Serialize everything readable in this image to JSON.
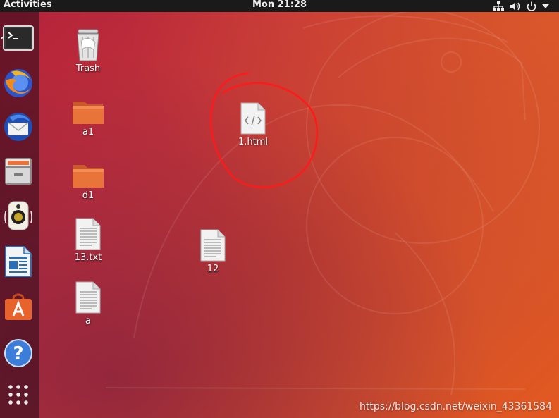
{
  "topbar": {
    "activities": "Activities",
    "clock": "Mon 21:28",
    "tray_icons": [
      "network-icon",
      "volume-icon",
      "power-icon",
      "chevron-down-icon"
    ]
  },
  "dock": {
    "items": [
      {
        "name": "Terminal",
        "icon": "terminal-icon"
      },
      {
        "name": "Firefox",
        "icon": "firefox-icon"
      },
      {
        "name": "Thunderbird",
        "icon": "thunderbird-icon"
      },
      {
        "name": "Files",
        "icon": "files-icon"
      },
      {
        "name": "Rhythmbox",
        "icon": "rhythmbox-icon"
      },
      {
        "name": "LibreOffice Writer",
        "icon": "writer-icon"
      },
      {
        "name": "Ubuntu Software",
        "icon": "software-icon"
      },
      {
        "name": "Help",
        "icon": "help-icon"
      },
      {
        "name": "Show Applications",
        "icon": "app-grid-icon"
      }
    ]
  },
  "desktop": {
    "icons": [
      {
        "label": "Trash",
        "icon": "trash-icon"
      },
      {
        "label": "a1",
        "icon": "folder-icon"
      },
      {
        "label": "d1",
        "icon": "folder-icon"
      },
      {
        "label": "13.txt",
        "icon": "text-file-icon"
      },
      {
        "label": "a",
        "icon": "text-file-icon"
      },
      {
        "label": "1.html",
        "icon": "html-file-icon"
      },
      {
        "label": "12",
        "icon": "text-file-icon"
      }
    ]
  },
  "watermark": "https://blog.csdn.net/weixin_43361584",
  "colors": {
    "topbar": "#1a1a1a",
    "wallpaper_start": "#b4213a",
    "wallpaper_end": "#e35a20",
    "annotation": "#ff1a1a",
    "folder": "#e8743a"
  }
}
